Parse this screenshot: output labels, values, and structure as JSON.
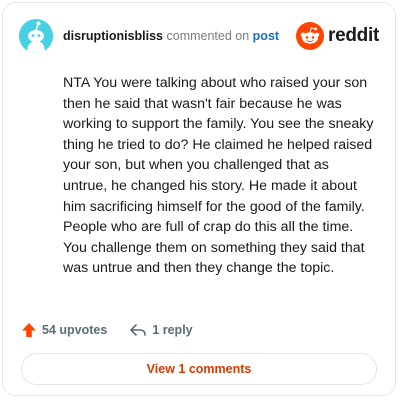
{
  "comment": {
    "username": "disruptionisbliss",
    "action_text": "commented on",
    "post_link": "post",
    "body": "NTA You were talking about who raised your son then he said that wasn't fair because he was working to support the family. You see the sneaky thing he tried to do? He claimed he helped raised your son, but when you challenged that as untrue, he changed his story. He made it about him sacrificing himself for the good of the family. People who are full of crap do this all the time. You challenge them on something they said that was untrue and then they change the topic.",
    "upvotes": "54 upvotes",
    "replies": "1 reply",
    "view_comments": "View 1 comments"
  },
  "brand": {
    "name": "reddit",
    "color": "#ff4500"
  },
  "icons": {
    "avatar": "snoo-avatar-icon",
    "logo": "reddit-logo-icon",
    "upvote": "upvote-arrow-icon",
    "reply": "reply-arrow-icon"
  },
  "colors": {
    "accent": "#d93a00",
    "link": "#1a6fc2",
    "upvote": "#ff4500",
    "avatar_bg": "#46d1e3"
  }
}
